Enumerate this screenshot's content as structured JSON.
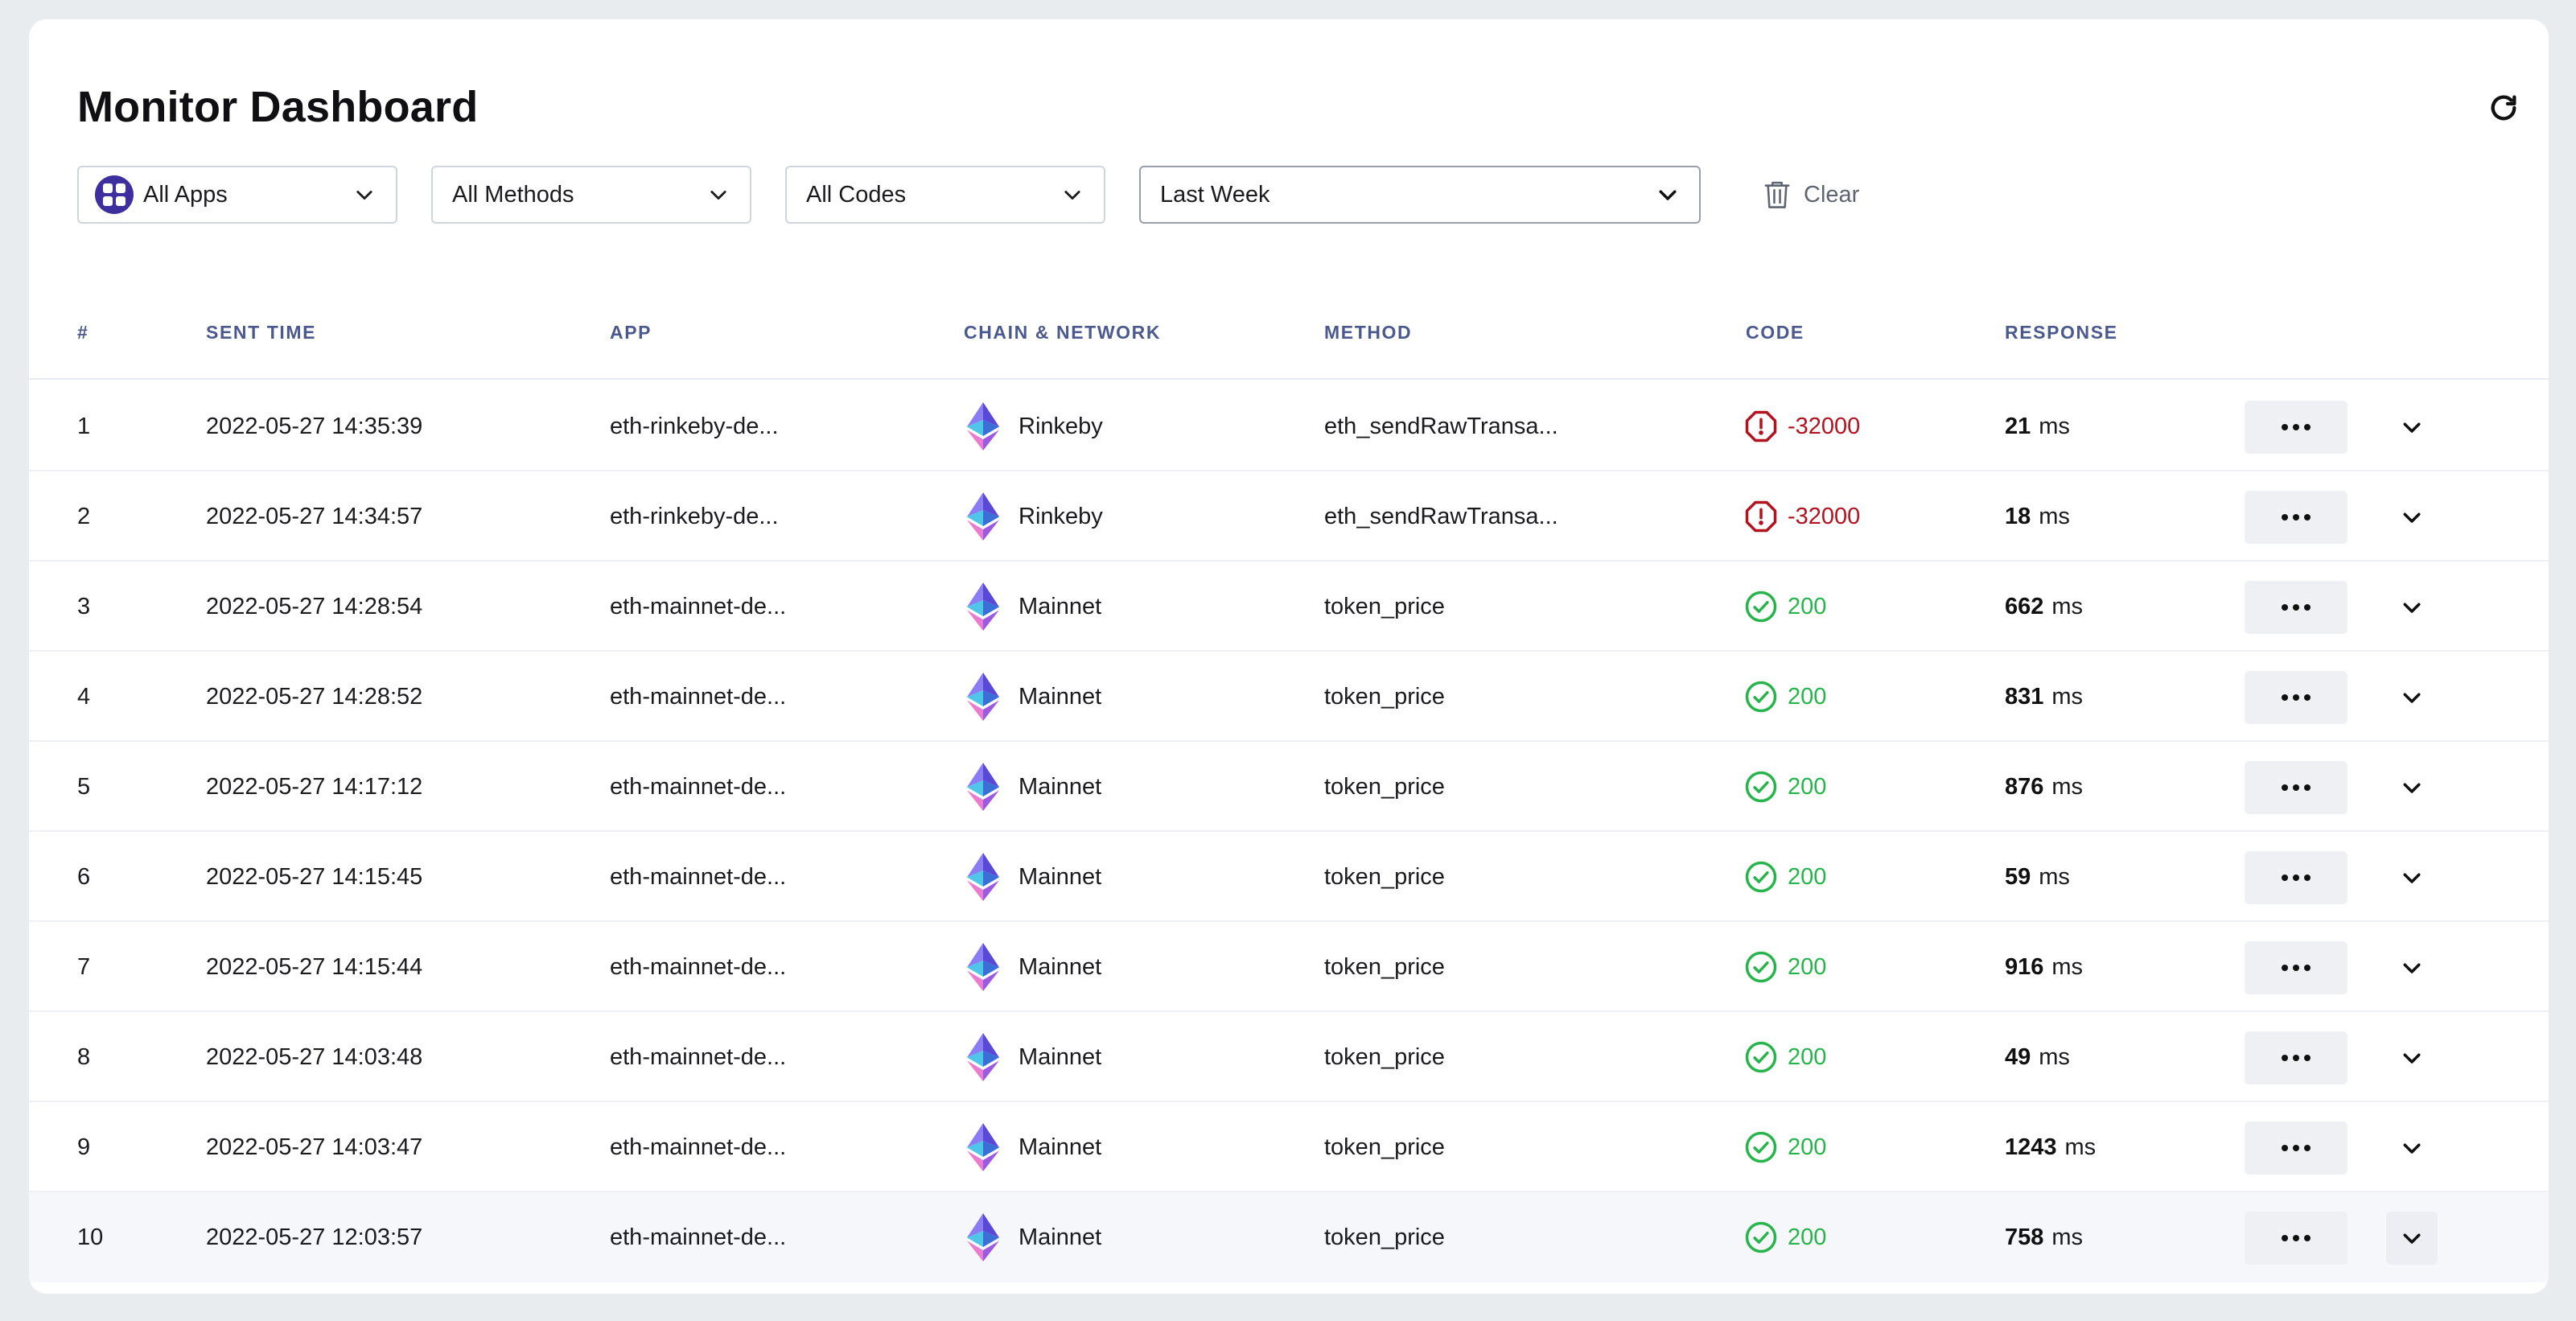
{
  "header": {
    "title": "Monitor Dashboard"
  },
  "icons": {
    "refresh": "refresh-icon",
    "clear": "trash-icon",
    "app": "apps-icon",
    "chain": "ethereum-icon"
  },
  "filters": {
    "apps": "All Apps",
    "methods": "All Methods",
    "codes": "All Codes",
    "range": "Last Week",
    "clear_label": "Clear"
  },
  "table": {
    "columns": [
      "#",
      "SENT TIME",
      "APP",
      "CHAIN & NETWORK",
      "METHOD",
      "CODE",
      "RESPONSE"
    ],
    "rows": [
      {
        "num": "1",
        "time": "2022-05-27 14:35:39",
        "app": "eth-rinkeby-de...",
        "network": "Rinkeby",
        "method": "eth_sendRawTransa...",
        "code": "-32000",
        "status": "error",
        "response": "21",
        "unit": "ms"
      },
      {
        "num": "2",
        "time": "2022-05-27 14:34:57",
        "app": "eth-rinkeby-de...",
        "network": "Rinkeby",
        "method": "eth_sendRawTransa...",
        "code": "-32000",
        "status": "error",
        "response": "18",
        "unit": "ms"
      },
      {
        "num": "3",
        "time": "2022-05-27 14:28:54",
        "app": "eth-mainnet-de...",
        "network": "Mainnet",
        "method": "token_price",
        "code": "200",
        "status": "ok",
        "response": "662",
        "unit": "ms"
      },
      {
        "num": "4",
        "time": "2022-05-27 14:28:52",
        "app": "eth-mainnet-de...",
        "network": "Mainnet",
        "method": "token_price",
        "code": "200",
        "status": "ok",
        "response": "831",
        "unit": "ms"
      },
      {
        "num": "5",
        "time": "2022-05-27 14:17:12",
        "app": "eth-mainnet-de...",
        "network": "Mainnet",
        "method": "token_price",
        "code": "200",
        "status": "ok",
        "response": "876",
        "unit": "ms"
      },
      {
        "num": "6",
        "time": "2022-05-27 14:15:45",
        "app": "eth-mainnet-de...",
        "network": "Mainnet",
        "method": "token_price",
        "code": "200",
        "status": "ok",
        "response": "59",
        "unit": "ms"
      },
      {
        "num": "7",
        "time": "2022-05-27 14:15:44",
        "app": "eth-mainnet-de...",
        "network": "Mainnet",
        "method": "token_price",
        "code": "200",
        "status": "ok",
        "response": "916",
        "unit": "ms"
      },
      {
        "num": "8",
        "time": "2022-05-27 14:03:48",
        "app": "eth-mainnet-de...",
        "network": "Mainnet",
        "method": "token_price",
        "code": "200",
        "status": "ok",
        "response": "49",
        "unit": "ms"
      },
      {
        "num": "9",
        "time": "2022-05-27 14:03:47",
        "app": "eth-mainnet-de...",
        "network": "Mainnet",
        "method": "token_price",
        "code": "200",
        "status": "ok",
        "response": "1243",
        "unit": "ms"
      },
      {
        "num": "10",
        "time": "2022-05-27 12:03:57",
        "app": "eth-mainnet-de...",
        "network": "Mainnet",
        "method": "token_price",
        "code": "200",
        "status": "ok",
        "response": "758",
        "unit": "ms"
      }
    ]
  },
  "colors": {
    "accent": "#3d2f9e",
    "error": "#b3121f",
    "success": "#27b44a",
    "header_text": "#4b5a8e"
  }
}
